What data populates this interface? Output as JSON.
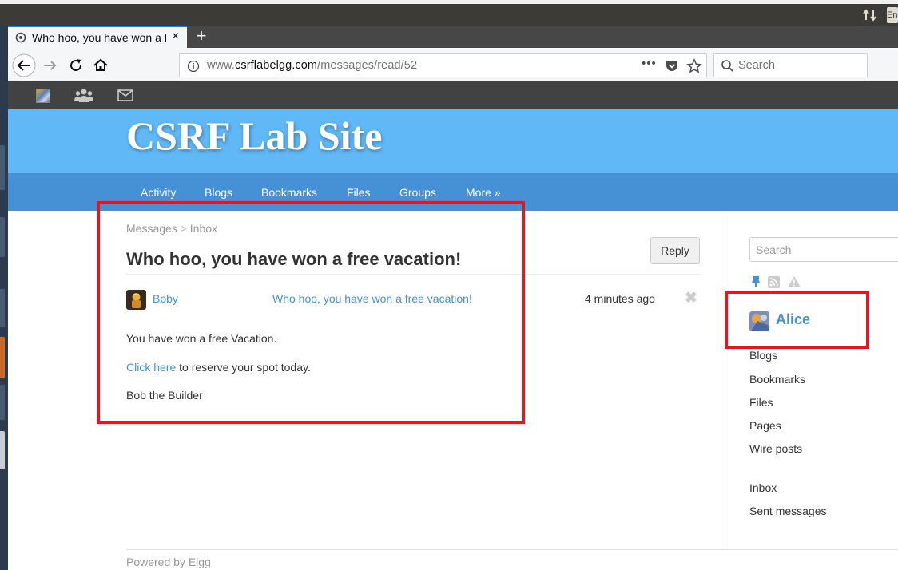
{
  "browser": {
    "tab_title": "Who hoo, you have won a free vacation!",
    "url_prefix": "www.",
    "url_host": "csrflabelgg.com",
    "url_path": "/messages/read/52",
    "search_placeholder": "Search",
    "os_indicator": "En"
  },
  "site": {
    "title": "CSRF Lab Site",
    "menu": [
      "Activity",
      "Blogs",
      "Bookmarks",
      "Files",
      "Groups",
      "More »"
    ]
  },
  "breadcrumb": {
    "parent": "Messages",
    "separator": ">",
    "current": "Inbox"
  },
  "message": {
    "title": "Who hoo, you have won a free vacation!",
    "reply_label": "Reply",
    "sender": "Boby",
    "subject_link": "Who hoo, you have won a free vacation!",
    "time": "4 minutes ago",
    "delete_icon": "✖",
    "body_line1": "You have won a free Vacation.",
    "body_link": "Click here",
    "body_line2_rest": " to reserve your spot today.",
    "signature": "Bob the Builder"
  },
  "sidebar": {
    "search_placeholder": "Search",
    "owner_name": "Alice",
    "links": [
      "Blogs",
      "Bookmarks",
      "Files",
      "Pages",
      "Wire posts"
    ],
    "message_links": [
      "Inbox",
      "Sent messages"
    ]
  },
  "footer": {
    "text": "Powered by Elgg"
  },
  "colors": {
    "annotation": "#e3171f",
    "link": "#4690d6",
    "header": "#60b8f7",
    "menu": "#4690d6"
  }
}
